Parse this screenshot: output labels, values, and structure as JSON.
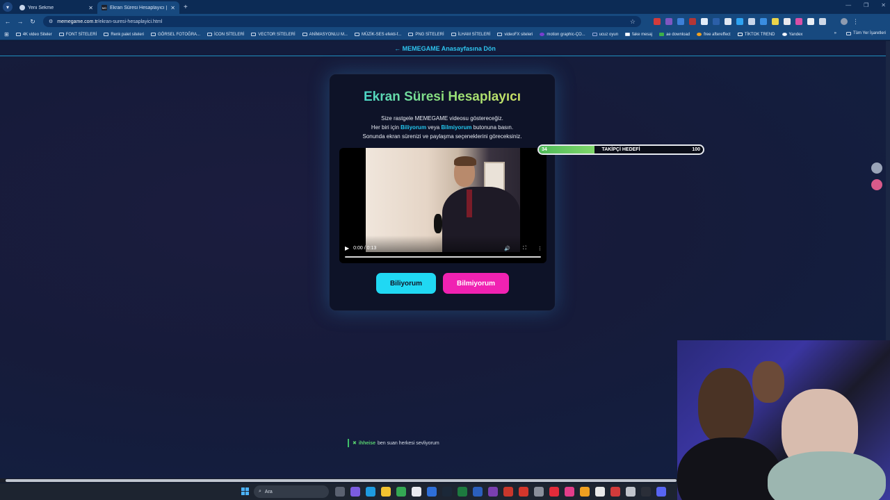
{
  "browser": {
    "tabs": [
      {
        "title": "Yeni Sekme",
        "active": false
      },
      {
        "title": "Ekran Süresi Hesaplayıcı | MEME",
        "active": true
      }
    ],
    "address": {
      "host": "memegame.com.tr",
      "path": "/ekran-suresi-hesaplayici.html"
    },
    "bookmarks": [
      "4K video Siteler",
      "FONT SİTELERİ",
      "Renk palet siteleri",
      "GÖRSEL FOTOĞRA...",
      "İCON SİTELERİ",
      "VECTOR SİTELERİ",
      "ANİMASYONLU M...",
      "MÜZİK-SES efekti-f...",
      "PNG SİTELERİ",
      "İLHAM SİTELERİ",
      "videoFX siteleri",
      "motion graphic-ÇO...",
      "ucuz oyun",
      "fake mesaj",
      "ae download",
      "free aftereffect",
      "TİKTOK TREND",
      "Yandex"
    ],
    "bookmarks_more": "»",
    "all_bookmarks": "Tüm Yer İşaretleri"
  },
  "page": {
    "back_link": "← MEMEGAME Anasayfasına Dön",
    "title": "Ekran Süresi Hesaplayıcı",
    "desc_line1": "Size rastgele MEMEGAME videosu göstereceğiz.",
    "desc_line2_pre": "Her biri için",
    "desc_line2_b1": "Biliyorum",
    "desc_line2_mid": "veya",
    "desc_line2_b2": "Bilmiyorum",
    "desc_line2_post": "butonuna basın.",
    "desc_line3": "Sonunda ekran sürenizi ve paylaşma seçeneklerini göreceksiniz.",
    "video": {
      "time": "0:00 / 0:13",
      "progress": 0
    },
    "btn_yes": "Biliyorum",
    "btn_no": "Bilmiyorum"
  },
  "follow_goal": {
    "current": "34",
    "label": "TAKİPÇİ HEDEFİ",
    "target": "100",
    "fraction": 0.34
  },
  "chat": {
    "user": "ihheise",
    "message": "ben suan herkesi sevliyorum"
  },
  "taskbar": {
    "search_placeholder": "Ara"
  },
  "colors": {
    "accent_cyan": "#20d8f3",
    "accent_pink": "#f022b2",
    "goal_green": "#4fba59"
  }
}
